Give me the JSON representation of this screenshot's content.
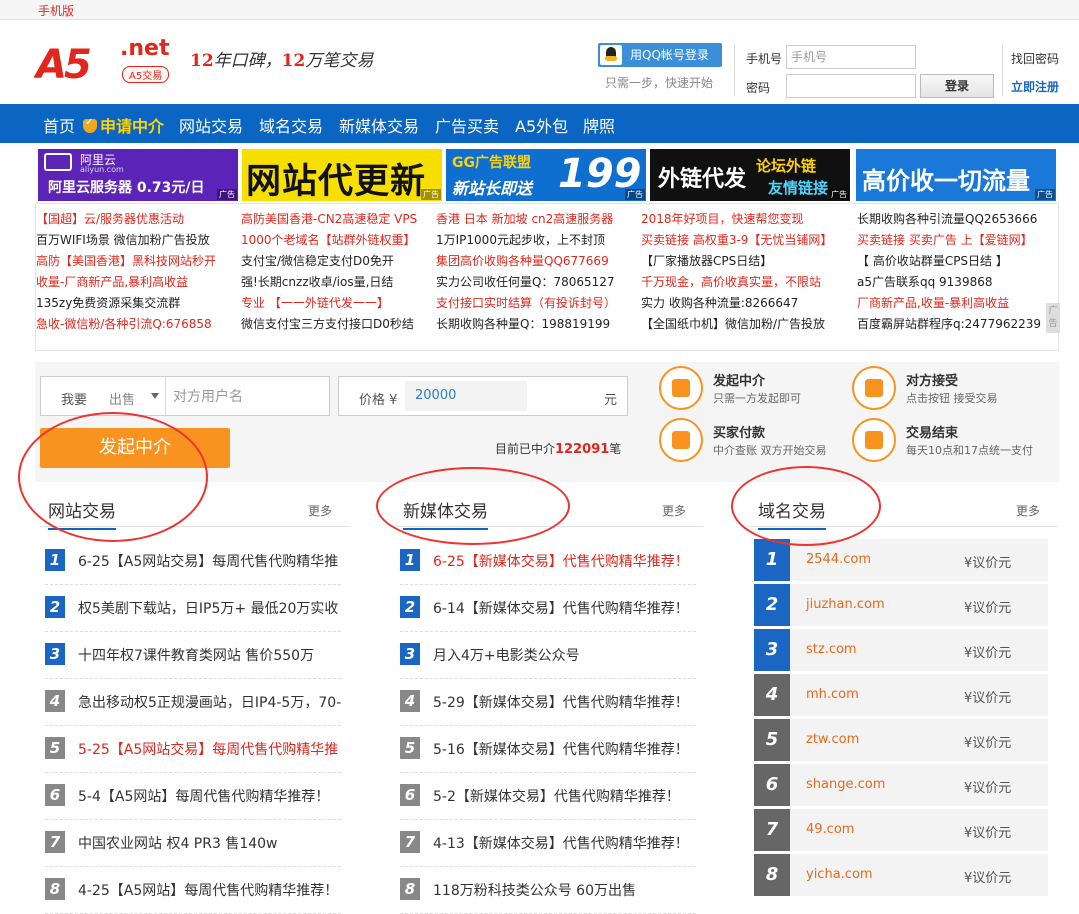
{
  "topbar": {
    "mobile": "手机版"
  },
  "header": {
    "logo_main": "A5",
    "logo_net": ".net",
    "logo_badge": "A5交易",
    "slogan_a": "12",
    "slogan_b": "年口碑，",
    "slogan_c": "12",
    "slogan_d": "万笔交易",
    "qq_login": "用QQ帐号登录",
    "qq_hint": "只需一步，快速开始",
    "phone_label": "手机号",
    "phone_placeholder": "手机号",
    "pwd_label": "密码",
    "login": "登录",
    "find_pw": "找回密码",
    "register": "立即注册"
  },
  "nav": [
    "首页",
    "申请中介",
    "网站交易",
    "域名交易",
    "新媒体交易",
    "广告买卖",
    "A5外包",
    "牌照"
  ],
  "banners": [
    {
      "line1": "阿里云",
      "line2": "aliyun.com",
      "line3": "阿里云服务器 0.73元/日",
      "tag": "广告",
      "bg": "#5b23b8"
    },
    {
      "text": "网站代更新",
      "tag": "广告",
      "bg": "#f7e000"
    },
    {
      "line1": "GG广告联盟",
      "line2": "新站长即送",
      "big": "199",
      "tag": "广告",
      "bg": "#0f6fd0"
    },
    {
      "line1": "外链代发",
      "line2": "论坛外链",
      "line3": "友情链接",
      "tag": "广告",
      "bg": "#101010"
    },
    {
      "text": "高价收一切流量",
      "tag": "广告",
      "bg": "#1a78d8"
    }
  ],
  "ads": [
    [
      {
        "t": "【国超】云/服务器优惠活动",
        "c": "red"
      },
      {
        "t": "百万WIFI场景 微信加粉广告投放",
        "c": "blk"
      },
      {
        "t": "高防【美国香港】黑科技网站秒开",
        "c": "red"
      },
      {
        "t": "收量-厂商新产品,暴利高收益",
        "c": "red"
      },
      {
        "t": "135zy免费资源采集交流群",
        "c": "blk"
      },
      {
        "t": "急收-微信粉/各种引流Q:676858",
        "c": "red"
      }
    ],
    [
      {
        "t": "高防美国香港-CN2高速稳定 VPS",
        "c": "red"
      },
      {
        "t": "1000个老域名【站群外链权重】",
        "c": "red"
      },
      {
        "t": "支付宝/微信稳定支付D0免开",
        "c": "blk"
      },
      {
        "t": "强!长期cnzz收卓/ios量,日结",
        "c": "blk"
      },
      {
        "t": "专业 【一一外链代发一一】",
        "c": "red"
      },
      {
        "t": "微信支付宝三方支付接口D0秒结",
        "c": "blk"
      }
    ],
    [
      {
        "t": "香港 日本 新加坡 cn2高速服务器",
        "c": "red"
      },
      {
        "t": "1万IP1000元起步收，上不封顶",
        "c": "blk"
      },
      {
        "t": "集团高价收购各种量QQ677669",
        "c": "red"
      },
      {
        "t": "实力公司收任何量Q：78065127",
        "c": "blk"
      },
      {
        "t": "支付接口实时结算（有投诉封号）",
        "c": "red"
      },
      {
        "t": "长期收购各种量Q：198819199",
        "c": "blk"
      }
    ],
    [
      {
        "t": "2018年好项目，快速帮您变现",
        "c": "red"
      },
      {
        "t": "买卖链接 高权重3-9【无忧当铺网】",
        "c": "red"
      },
      {
        "t": "【厂家播放器CPS日结】",
        "c": "blk"
      },
      {
        "t": "千万现金，高价收真实量，不限站",
        "c": "red"
      },
      {
        "t": "实力 收购各种流量:8266647",
        "c": "blk"
      },
      {
        "t": "【全国纸巾机】微信加粉/广告投放",
        "c": "blk"
      }
    ],
    [
      {
        "t": "长期收购各种引流量QQ2653666",
        "c": "blk"
      },
      {
        "t": "买卖链接 买卖广告 上【爱链网】",
        "c": "red"
      },
      {
        "t": "【 高价收站群量CPS日结 】",
        "c": "blk"
      },
      {
        "t": "a5广告联系qq 9139868",
        "c": "blk"
      },
      {
        "t": "厂商新产品,收量-暴利高收益",
        "c": "red"
      },
      {
        "t": "百度霸屏站群程序q:2477962239",
        "c": "blk"
      }
    ]
  ],
  "side_tab": "广告",
  "deal": {
    "want": "我要",
    "mode": "出售",
    "user_placeholder": "对方用户名",
    "price_label": "价格 ¥",
    "price_value": "20000",
    "unit": "元",
    "start": "发起中介",
    "counter_pre": "目前已中介",
    "counter_num": "122091",
    "counter_post": "笔",
    "steps": [
      {
        "title": "发起中介",
        "desc": "只需一方发起即可",
        "icon": "hammer-icon"
      },
      {
        "title": "对方接受",
        "desc": "点击按钮 接受交易",
        "icon": "person-check-icon"
      },
      {
        "title": "买家付款",
        "desc": "中介查账 双方开始交易",
        "icon": "card-icon"
      },
      {
        "title": "交易结束",
        "desc": "每天10点和17点统一支付",
        "icon": "handshake-icon"
      }
    ]
  },
  "sections": {
    "more": "更多",
    "website": {
      "title": "网站交易",
      "items": [
        {
          "t": "6-25【A5网站交易】每周代售代购精华推",
          "red": false
        },
        {
          "t": "权5美剧下载站，日IP5万+ 最低20万实收",
          "red": false
        },
        {
          "t": "十四年权7课件教育类网站 售价550万",
          "red": false
        },
        {
          "t": "急出移动权5正规漫画站，日IP4-5万，70-",
          "red": false
        },
        {
          "t": "5-25【A5网站交易】每周代售代购精华推",
          "red": true
        },
        {
          "t": "5-4【A5网站】每周代售代购精华推荐！",
          "red": false
        },
        {
          "t": "中国农业网站 权4 PR3 售140w",
          "red": false
        },
        {
          "t": "4-25【A5网站】每周代售代购精华推荐！",
          "red": false
        }
      ]
    },
    "media": {
      "title": "新媒体交易",
      "items": [
        {
          "t": "6-25【新媒体交易】代售代购精华推荐！",
          "red": true
        },
        {
          "t": "6-14【新媒体交易】代售代购精华推荐！",
          "red": false
        },
        {
          "t": "月入4万+电影类公众号",
          "red": false
        },
        {
          "t": "5-29【新媒体交易】代售代购精华推荐！",
          "red": false
        },
        {
          "t": "5-16【新媒体交易】代售代购精华推荐！",
          "red": false
        },
        {
          "t": "5-2【新媒体交易】代售代购精华推荐！",
          "red": false
        },
        {
          "t": "4-13【新媒体交易】代售代购精华推荐！",
          "red": false
        },
        {
          "t": "118万粉科技类公众号 60万出售",
          "red": false
        }
      ]
    },
    "domain": {
      "title": "域名交易",
      "items": [
        {
          "d": "2544.com",
          "p": "¥议价元"
        },
        {
          "d": "jiuzhan.com",
          "p": "¥议价元"
        },
        {
          "d": "stz.com",
          "p": "¥议价元"
        },
        {
          "d": "mh.com",
          "p": "¥议价元"
        },
        {
          "d": "ztw.com",
          "p": "¥议价元"
        },
        {
          "d": "shange.com",
          "p": "¥议价元"
        },
        {
          "d": "49.com",
          "p": "¥议价元"
        },
        {
          "d": "yicha.com",
          "p": "¥议价元"
        }
      ]
    }
  },
  "colors": {
    "brand_red": "#e2261c",
    "nav_blue": "#0a66c2",
    "orange": "#f7931e",
    "annotation_red": "#e33"
  }
}
